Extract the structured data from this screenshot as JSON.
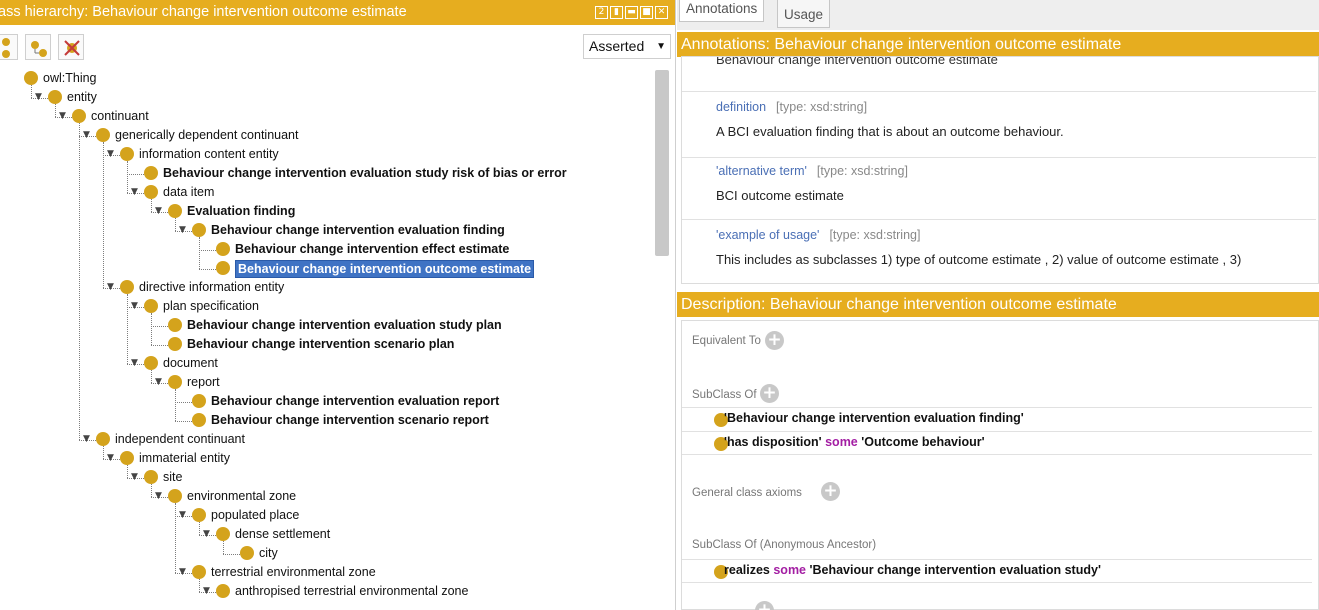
{
  "left_panel": {
    "title": "ass hierarchy: Behaviour change intervention outcome estimate",
    "window_controls": [
      "2",
      "▮",
      "▬",
      "■",
      "✕"
    ],
    "toolbar": {
      "view_mode": "Asserted"
    },
    "tree": [
      {
        "label": "owl:Thing",
        "bold": false
      },
      {
        "label": "entity",
        "bold": false
      },
      {
        "label": "continuant",
        "bold": false
      },
      {
        "label": "generically dependent continuant",
        "bold": false
      },
      {
        "label": "information content entity",
        "bold": false
      },
      {
        "label": "Behaviour change intervention evaluation study risk of bias or error",
        "bold": true
      },
      {
        "label": "data item",
        "bold": false
      },
      {
        "label": "Evaluation finding",
        "bold": true
      },
      {
        "label": "Behaviour change intervention evaluation finding",
        "bold": true
      },
      {
        "label": "Behaviour change intervention effect estimate",
        "bold": true
      },
      {
        "label": "Behaviour change intervention outcome estimate",
        "bold": true,
        "selected": true
      },
      {
        "label": "directive information entity",
        "bold": false
      },
      {
        "label": "plan specification",
        "bold": false
      },
      {
        "label": "Behaviour change intervention evaluation study plan",
        "bold": true
      },
      {
        "label": "Behaviour change intervention scenario plan",
        "bold": true
      },
      {
        "label": "document",
        "bold": false
      },
      {
        "label": "report",
        "bold": false
      },
      {
        "label": "Behaviour change intervention evaluation report",
        "bold": true
      },
      {
        "label": "Behaviour change intervention scenario report",
        "bold": true
      },
      {
        "label": "independent continuant",
        "bold": false
      },
      {
        "label": "immaterial entity",
        "bold": false
      },
      {
        "label": "site",
        "bold": false
      },
      {
        "label": "environmental zone",
        "bold": false
      },
      {
        "label": "populated place",
        "bold": false
      },
      {
        "label": "dense settlement",
        "bold": false
      },
      {
        "label": "city",
        "bold": false
      },
      {
        "label": "terrestrial environmental zone",
        "bold": false
      },
      {
        "label": "anthropised terrestrial environmental zone",
        "bold": false
      }
    ]
  },
  "right_panel": {
    "tabs": [
      {
        "label": "Annotations",
        "active": true
      },
      {
        "label": "Usage",
        "active": false
      }
    ],
    "annotations": {
      "title": "Annotations: Behaviour change intervention outcome estimate",
      "cut_text": "Behaviour change intervention outcome estimate",
      "items": [
        {
          "key": "definition",
          "type": "[type: xsd:string]",
          "value": "A BCI evaluation finding that is about an outcome behaviour."
        },
        {
          "key": "'alternative term'",
          "type": "[type: xsd:string]",
          "value": "BCI outcome estimate"
        },
        {
          "key": "'example of usage'",
          "type": "[type: xsd:string]",
          "value": "This includes as subclasses 1) type of outcome estimate , 2) value of outcome estimate , 3)"
        }
      ]
    },
    "description": {
      "title": "Description: Behaviour change intervention outcome estimate",
      "equivalent_to": "Equivalent To",
      "subclass_of": "SubClass Of",
      "subclass_axioms": [
        {
          "prefix": "'Behaviour change intervention evaluation finding'",
          "keyword": "",
          "suffix": ""
        },
        {
          "prefix": "'has disposition'",
          "keyword": "some",
          "suffix": "'Outcome behaviour'"
        }
      ],
      "general_class_axioms": "General class axioms",
      "anonymous_ancestor": "SubClass Of (Anonymous Ancestor)",
      "ancestor_axioms": [
        {
          "prefix": "realizes",
          "keyword": "some",
          "suffix": "'Behaviour change intervention evaluation study'"
        }
      ]
    }
  }
}
